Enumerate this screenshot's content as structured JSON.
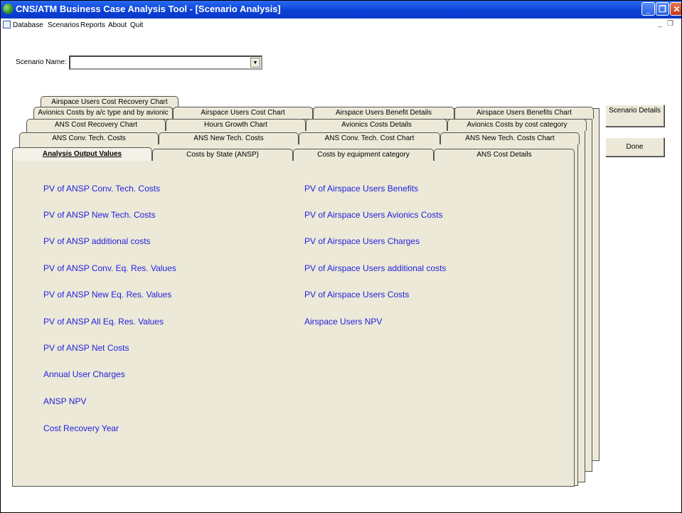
{
  "window": {
    "title": "CNS/ATM Business Case Analysis Tool - [Scenario Analysis]"
  },
  "menu": [
    "Database",
    "Scenarios",
    "Reports",
    "About",
    "Quit"
  ],
  "scenario": {
    "label": "Scenario Name:",
    "value": ""
  },
  "buttons": {
    "details": "Scenario Details",
    "done": "Done"
  },
  "tabs": {
    "row1": [
      "Airspace Users Cost Recovery Chart"
    ],
    "row2": [
      "Avionics Costs by a/c type and by avionic",
      "Airspace Users Cost Chart",
      "Airspace Users Benefit Details",
      "Airspace Users Benefits Chart"
    ],
    "row3": [
      "ANS Cost Recovery Chart",
      "Hours Growth Chart",
      "Avionics Costs Details",
      "Avionics Costs by cost category"
    ],
    "row4": [
      "ANS Conv. Tech. Costs",
      "ANS New Tech. Costs",
      "ANS Conv. Tech. Cost Chart",
      "ANS New Tech. Costs Chart"
    ],
    "row5": [
      "Analysis Output Values",
      "Costs by State (ANSP)",
      "Costs by equipment category",
      "ANS Cost Details"
    ]
  },
  "outputs": {
    "left": [
      "PV of ANSP Conv. Tech. Costs",
      "PV of ANSP New Tech. Costs",
      "PV of ANSP additional costs",
      "PV of ANSP Conv. Eq. Res. Values",
      "PV of ANSP New Eq. Res. Values",
      "PV of ANSP All Eq. Res. Values",
      "PV of ANSP Net Costs",
      "Annual User Charges",
      "ANSP NPV",
      "Cost Recovery Year"
    ],
    "right": [
      "PV of Airspace Users Benefits",
      "PV of Airspace Users Avionics Costs",
      "PV of Airspace Users Charges",
      "PV of Airspace Users additional costs",
      "PV of Airspace Users Costs",
      "Airspace Users NPV"
    ]
  }
}
